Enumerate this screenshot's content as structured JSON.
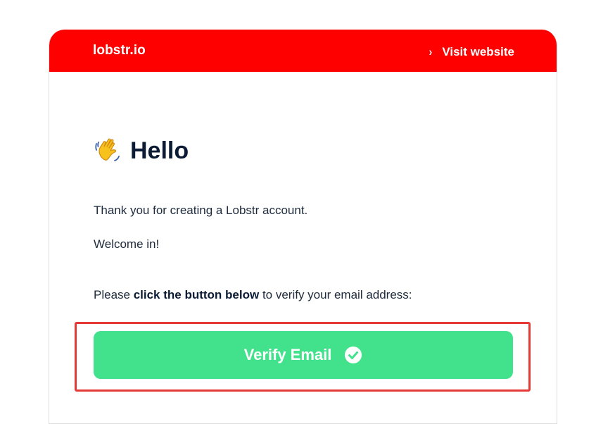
{
  "header": {
    "brand": "lobstr.io",
    "chevron": "›",
    "visit_label": "Visit website",
    "background_color": "#ff0000"
  },
  "greeting": {
    "icon": "waving-hand-icon",
    "title": "Hello"
  },
  "body": {
    "line1": "Thank you for creating a Lobstr account.",
    "line2": "Welcome in!",
    "line3_prefix": "Please ",
    "line3_bold": "click the button below",
    "line3_suffix": " to verify your email address:"
  },
  "verify_button": {
    "label": "Verify Email",
    "icon": "check-circle-icon",
    "color": "#42e28d"
  },
  "annotation": {
    "highlight_color": "#e53935"
  }
}
